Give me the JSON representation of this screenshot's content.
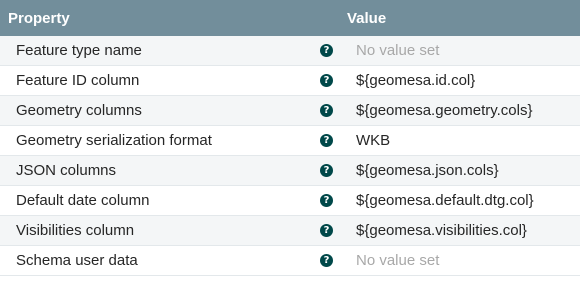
{
  "header": {
    "property_label": "Property",
    "value_label": "Value"
  },
  "help_icon_glyph": "?",
  "rows": [
    {
      "property": "Feature type name",
      "value": "No value set",
      "unset": true
    },
    {
      "property": "Feature ID column",
      "value": "${geomesa.id.col}",
      "unset": false
    },
    {
      "property": "Geometry columns",
      "value": "${geomesa.geometry.cols}",
      "unset": false
    },
    {
      "property": "Geometry serialization format",
      "value": "WKB",
      "unset": false
    },
    {
      "property": "JSON columns",
      "value": "${geomesa.json.cols}",
      "unset": false
    },
    {
      "property": "Default date column",
      "value": "${geomesa.default.dtg.col}",
      "unset": false
    },
    {
      "property": "Visibilities column",
      "value": "${geomesa.visibilities.col}",
      "unset": false
    },
    {
      "property": "Schema user data",
      "value": "No value set",
      "unset": true
    }
  ],
  "colors": {
    "header_bg": "#728e9b",
    "help_icon": "#004849",
    "unset_text": "#a8a8a8"
  }
}
